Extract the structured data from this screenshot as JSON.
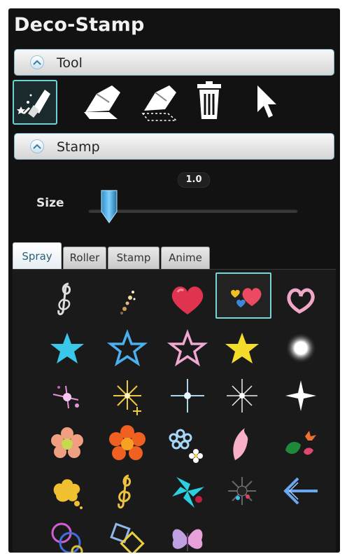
{
  "app": {
    "title": "Deco-Stamp"
  },
  "sections": {
    "tool": "Tool",
    "stamp": "Stamp"
  },
  "toolbar": {
    "tools": [
      {
        "name": "spray-brush-tool",
        "icon": "spray-brush-icon",
        "selected": true
      },
      {
        "name": "eraser-tool",
        "icon": "eraser-icon",
        "selected": false
      },
      {
        "name": "partial-eraser-tool",
        "icon": "dotted-eraser-icon",
        "selected": false
      },
      {
        "name": "trash-tool",
        "icon": "trash-icon",
        "selected": false
      },
      {
        "name": "pointer-tool",
        "icon": "cursor-arrow-icon",
        "selected": false
      }
    ]
  },
  "size": {
    "label": "Size",
    "value": "1.0",
    "level": 0.1
  },
  "tabs": [
    "Spray",
    "Roller",
    "Stamp",
    "Anime"
  ],
  "active_tab": "Spray",
  "stamps": [
    {
      "name": "treble-clef"
    },
    {
      "name": "sparkle-trail"
    },
    {
      "name": "red-heart"
    },
    {
      "name": "small-hearts",
      "selected": true
    },
    {
      "name": "heart-outline"
    },
    {
      "name": "cyan-star"
    },
    {
      "name": "blue-outline-star"
    },
    {
      "name": "pink-outline-star"
    },
    {
      "name": "yellow-star"
    },
    {
      "name": "white-glow"
    },
    {
      "name": "pink-sparkle"
    },
    {
      "name": "gold-sparkle"
    },
    {
      "name": "blue-twinkle"
    },
    {
      "name": "white-twinkle"
    },
    {
      "name": "white-four-point-star"
    },
    {
      "name": "pink-flower"
    },
    {
      "name": "orange-flower"
    },
    {
      "name": "blue-flowers"
    },
    {
      "name": "pink-petal"
    },
    {
      "name": "autumn-leaves"
    },
    {
      "name": "yellow-blob"
    },
    {
      "name": "gold-clef"
    },
    {
      "name": "cyan-pinwheel"
    },
    {
      "name": "dark-burst"
    },
    {
      "name": "blue-arrow"
    },
    {
      "name": "circle-rings"
    },
    {
      "name": "square-outlines"
    },
    {
      "name": "butterfly"
    }
  ]
}
